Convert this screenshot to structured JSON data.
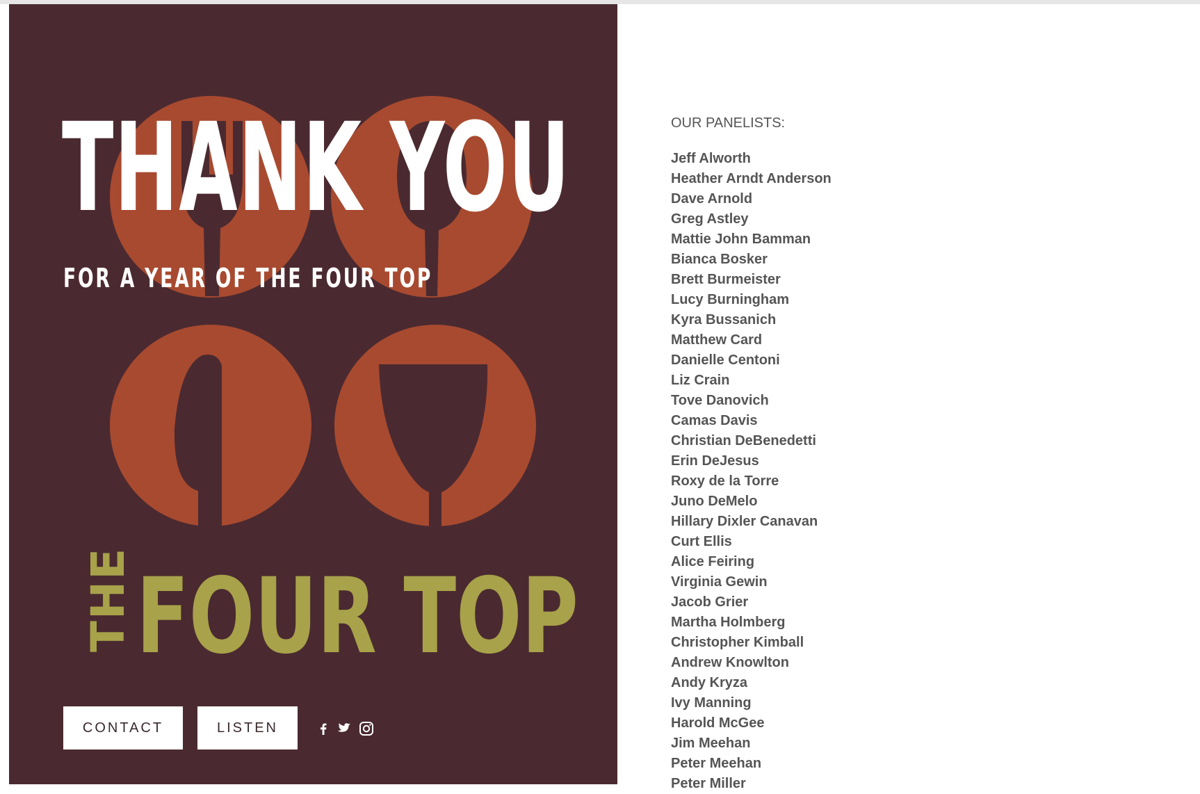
{
  "hero": {
    "headline": "THANK YOU",
    "tagline": "FOR A YEAR OF THE FOUR TOP",
    "brand_prefix": "THE",
    "brand_name": "FOUR TOP",
    "colors": {
      "background": "#4a2a30",
      "circle": "#a84a30",
      "brand": "#a8a24a",
      "text": "#ffffff"
    },
    "icons": [
      "fork-icon",
      "spoon-icon",
      "knife-icon",
      "wine-glass-icon"
    ]
  },
  "nav": {
    "contact_label": "CONTACT",
    "listen_label": "LISTEN",
    "social": [
      "facebook-icon",
      "twitter-icon",
      "instagram-icon"
    ]
  },
  "panelists": {
    "heading": "OUR PANELISTS:",
    "names": [
      "Jeff Alworth",
      "Heather Arndt Anderson",
      "Dave Arnold",
      "Greg Astley",
      "Mattie John Bamman",
      "Bianca Bosker",
      "Brett Burmeister",
      "Lucy Burningham",
      "Kyra Bussanich",
      "Matthew Card",
      "Danielle Centoni",
      "Liz Crain",
      "Tove Danovich",
      "Camas Davis",
      "Christian DeBenedetti",
      "Erin DeJesus",
      "Roxy de la Torre",
      "Juno DeMelo",
      "Hillary Dixler Canavan",
      "Curt Ellis",
      "Alice Feiring",
      "Virginia Gewin",
      "Jacob Grier",
      "Martha Holmberg",
      "Christopher Kimball",
      "Andrew Knowlton",
      "Andy Kryza",
      "Ivy Manning",
      "Harold McGee",
      "Jim Meehan",
      "Peter Meehan",
      "Peter Miller"
    ]
  }
}
